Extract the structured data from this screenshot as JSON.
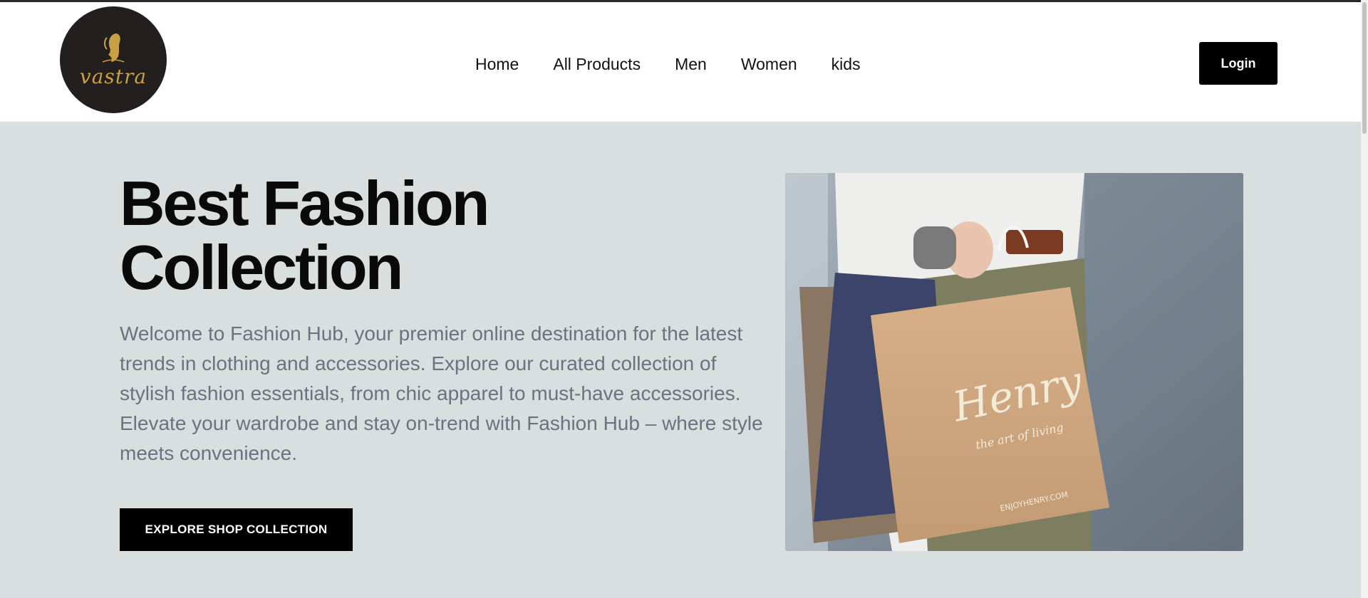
{
  "brand": {
    "logo_text": "vastra",
    "logo_color": "#c9a043",
    "logo_bg": "#231f1e"
  },
  "nav": {
    "links": [
      {
        "label": "Home"
      },
      {
        "label": "All Products"
      },
      {
        "label": "Men"
      },
      {
        "label": "Women"
      },
      {
        "label": "kids"
      }
    ],
    "login_label": "Login"
  },
  "hero": {
    "title": "Best Fashion Collection",
    "description": "Welcome to Fashion Hub, your premier online destination for the latest trends in clothing and accessories. Explore our curated collection of stylish fashion essentials, from chic apparel to must-have accessories. Elevate your wardrobe and stay on-trend with Fashion Hub – where style meets convenience.",
    "cta_label": "EXPLORE SHOP COLLECTION",
    "image": {
      "bag_brand": "Henry",
      "bag_tagline": "the art of living",
      "bag_url": "ENJOYHENRY.COM"
    }
  },
  "colors": {
    "hero_bg": "#d9dede",
    "button_bg": "#000000",
    "text_muted": "#6b7280"
  }
}
